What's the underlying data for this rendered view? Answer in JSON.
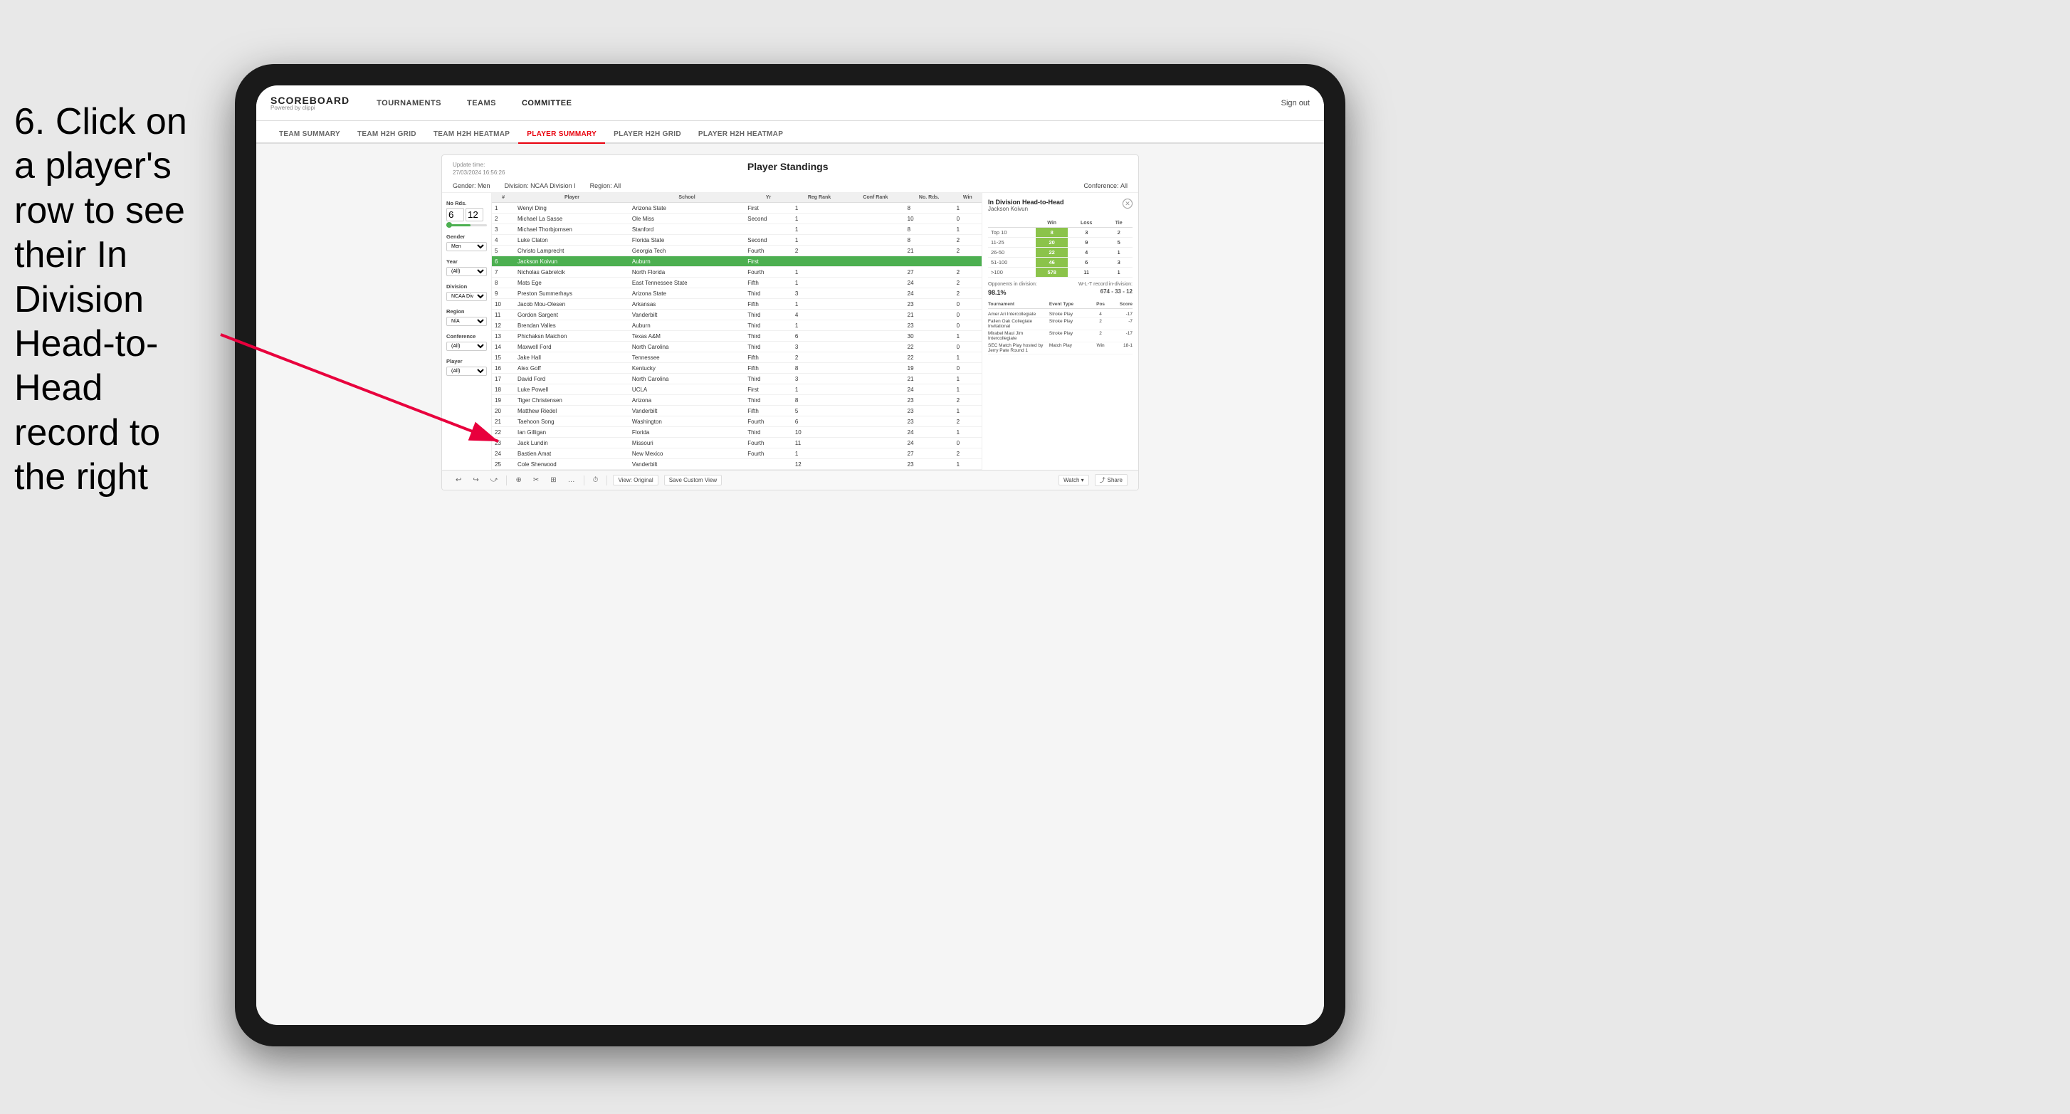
{
  "instruction": {
    "text": "6. Click on a player's row to see their In Division Head-to-Head record to the right"
  },
  "app": {
    "logo": {
      "scoreboard": "SCOREBOARD",
      "powered": "Powered by clippi"
    },
    "nav": {
      "items": [
        "TOURNAMENTS",
        "TEAMS",
        "COMMITTEE"
      ],
      "sign_out": "Sign out"
    },
    "sub_nav": {
      "items": [
        "TEAM SUMMARY",
        "TEAM H2H GRID",
        "TEAM H2H HEATMAP",
        "PLAYER SUMMARY",
        "PLAYER H2H GRID",
        "PLAYER H2H HEATMAP"
      ],
      "active": "PLAYER SUMMARY"
    }
  },
  "standings": {
    "title": "Player Standings",
    "update_time_label": "Update time:",
    "update_time": "27/03/2024 16:56:26",
    "filters": {
      "gender_label": "Gender:",
      "gender": "Men",
      "division_label": "Division:",
      "division": "NCAA Division I",
      "region_label": "Region:",
      "region": "All",
      "conference_label": "Conference:",
      "conference": "All"
    },
    "sidebar": {
      "no_rds_label": "No Rds.",
      "no_rds_from": "6",
      "no_rds_to": "12",
      "gender_label": "Gender",
      "gender_value": "Men",
      "year_label": "Year",
      "year_value": "(All)",
      "division_label": "Division",
      "division_value": "NCAA Division I",
      "region_label": "Region",
      "region_value": "N/A",
      "conference_label": "Conference",
      "conference_value": "(All)",
      "player_label": "Player",
      "player_value": "(All)"
    },
    "table": {
      "headers": [
        "#",
        "Player",
        "School",
        "Yr",
        "Reg Rank",
        "Conf Rank",
        "No. Rds.",
        "Win"
      ],
      "rows": [
        {
          "num": 1,
          "player": "Wenyi Ding",
          "school": "Arizona State",
          "yr": "First",
          "reg": 1,
          "conf": "",
          "rds": 8,
          "win": 1,
          "highlighted": false
        },
        {
          "num": 2,
          "player": "Michael La Sasse",
          "school": "Ole Miss",
          "yr": "Second",
          "reg": 1,
          "conf": "",
          "rds": 10,
          "win": 0,
          "highlighted": false
        },
        {
          "num": 3,
          "player": "Michael Thorbjornsen",
          "school": "Stanford",
          "yr": "",
          "reg": 1,
          "conf": "",
          "rds": 8,
          "win": 1,
          "highlighted": false
        },
        {
          "num": 4,
          "player": "Luke Claton",
          "school": "Florida State",
          "yr": "Second",
          "reg": 1,
          "conf": "",
          "rds": 8,
          "win": 2,
          "highlighted": false
        },
        {
          "num": 5,
          "player": "Christo Lamprecht",
          "school": "Georgia Tech",
          "yr": "Fourth",
          "reg": 2,
          "conf": "",
          "rds": 21,
          "win": 2,
          "highlighted": false
        },
        {
          "num": 6,
          "player": "Jackson Koivun",
          "school": "Auburn",
          "yr": "First",
          "reg": "",
          "conf": "",
          "rds": "",
          "win": "",
          "highlighted": true
        },
        {
          "num": 7,
          "player": "Nicholas Gabrelcik",
          "school": "North Florida",
          "yr": "Fourth",
          "reg": 1,
          "conf": "",
          "rds": 27,
          "win": 2,
          "highlighted": false
        },
        {
          "num": 8,
          "player": "Mats Ege",
          "school": "East Tennessee State",
          "yr": "Fifth",
          "reg": 1,
          "conf": "",
          "rds": 24,
          "win": 2,
          "highlighted": false
        },
        {
          "num": 9,
          "player": "Preston Summerhays",
          "school": "Arizona State",
          "yr": "Third",
          "reg": 3,
          "conf": "",
          "rds": 24,
          "win": 2,
          "highlighted": false
        },
        {
          "num": 10,
          "player": "Jacob Mou-Olesen",
          "school": "Arkansas",
          "yr": "Fifth",
          "reg": 1,
          "conf": "",
          "rds": 23,
          "win": 0,
          "highlighted": false
        },
        {
          "num": 11,
          "player": "Gordon Sargent",
          "school": "Vanderbilt",
          "yr": "Third",
          "reg": 4,
          "conf": "",
          "rds": 21,
          "win": 0,
          "highlighted": false
        },
        {
          "num": 12,
          "player": "Brendan Valles",
          "school": "Auburn",
          "yr": "Third",
          "reg": 1,
          "conf": "",
          "rds": 23,
          "win": 0,
          "highlighted": false
        },
        {
          "num": 13,
          "player": "Phichaksn Maichon",
          "school": "Texas A&M",
          "yr": "Third",
          "reg": 6,
          "conf": "",
          "rds": 30,
          "win": 1,
          "highlighted": false
        },
        {
          "num": 14,
          "player": "Maxwell Ford",
          "school": "North Carolina",
          "yr": "Third",
          "reg": 3,
          "conf": "",
          "rds": 22,
          "win": 0,
          "highlighted": false
        },
        {
          "num": 15,
          "player": "Jake Hall",
          "school": "Tennessee",
          "yr": "Fifth",
          "reg": 2,
          "conf": "",
          "rds": 22,
          "win": 1,
          "highlighted": false
        },
        {
          "num": 16,
          "player": "Alex Goff",
          "school": "Kentucky",
          "yr": "Fifth",
          "reg": 8,
          "conf": "",
          "rds": 19,
          "win": 0,
          "highlighted": false
        },
        {
          "num": 17,
          "player": "David Ford",
          "school": "North Carolina",
          "yr": "Third",
          "reg": 3,
          "conf": "",
          "rds": 21,
          "win": 1,
          "highlighted": false
        },
        {
          "num": 18,
          "player": "Luke Powell",
          "school": "UCLA",
          "yr": "First",
          "reg": 1,
          "conf": "",
          "rds": 24,
          "win": 1,
          "highlighted": false
        },
        {
          "num": 19,
          "player": "Tiger Christensen",
          "school": "Arizona",
          "yr": "Third",
          "reg": 8,
          "conf": "",
          "rds": 23,
          "win": 2,
          "highlighted": false
        },
        {
          "num": 20,
          "player": "Matthew Riedel",
          "school": "Vanderbilt",
          "yr": "Fifth",
          "reg": 5,
          "conf": "",
          "rds": 23,
          "win": 1,
          "highlighted": false
        },
        {
          "num": 21,
          "player": "Taehoon Song",
          "school": "Washington",
          "yr": "Fourth",
          "reg": 6,
          "conf": "",
          "rds": 23,
          "win": 2,
          "highlighted": false
        },
        {
          "num": 22,
          "player": "Ian Gilligan",
          "school": "Florida",
          "yr": "Third",
          "reg": 10,
          "conf": "",
          "rds": 24,
          "win": 1,
          "highlighted": false
        },
        {
          "num": 23,
          "player": "Jack Lundin",
          "school": "Missouri",
          "yr": "Fourth",
          "reg": 11,
          "conf": "",
          "rds": 24,
          "win": 0,
          "highlighted": false
        },
        {
          "num": 24,
          "player": "Bastien Amat",
          "school": "New Mexico",
          "yr": "Fourth",
          "reg": 1,
          "conf": "",
          "rds": 27,
          "win": 2,
          "highlighted": false
        },
        {
          "num": 25,
          "player": "Cole Sherwood",
          "school": "Vanderbilt",
          "yr": "",
          "reg": 12,
          "conf": "",
          "rds": 23,
          "win": 1,
          "highlighted": false
        }
      ]
    }
  },
  "h2h": {
    "title": "In Division Head-to-Head",
    "player": "Jackson Koivun",
    "table": {
      "headers": [
        "",
        "Win",
        "Loss",
        "Tie"
      ],
      "rows": [
        {
          "rank": "Top 10",
          "win": 8,
          "loss": 3,
          "tie": 2
        },
        {
          "rank": "11-25",
          "win": 20,
          "loss": 9,
          "tie": 5
        },
        {
          "rank": "26-50",
          "win": 22,
          "loss": 4,
          "tie": 1
        },
        {
          "rank": "51-100",
          "win": 46,
          "loss": 6,
          "tie": 3
        },
        {
          "rank": ">100",
          "win": 578,
          "loss": 11,
          "tie": 1
        }
      ]
    },
    "opponents_label": "Opponents in division:",
    "wlt_label": "W-L-T record in-division:",
    "percent": "98.1%",
    "record": "674 - 33 - 12",
    "tournaments": {
      "headers": [
        "Tournament",
        "Event Type",
        "Pos",
        "Score"
      ],
      "rows": [
        {
          "name": "Amer Ari Intercollegiate",
          "type": "Stroke Play",
          "pos": 4,
          "score": "-17"
        },
        {
          "name": "Fallen Oak Collegiate Invitational",
          "type": "Stroke Play",
          "pos": 2,
          "score": "-7"
        },
        {
          "name": "Mirabel Maui Jim Intercollegiate",
          "type": "Stroke Play",
          "pos": 2,
          "score": "-17"
        },
        {
          "name": "SEC Match Play hosted by Jerry Pate Round 1",
          "type": "Match Play",
          "pos": "Win",
          "score": "18-1"
        }
      ]
    }
  },
  "toolbar": {
    "buttons": [
      "↩",
      "↪",
      "⤻",
      "⊕",
      "✂",
      "⊞",
      "…",
      "⟳"
    ],
    "view_original": "View: Original",
    "save_custom": "Save Custom View",
    "watch": "Watch ▾",
    "share": "Share"
  }
}
